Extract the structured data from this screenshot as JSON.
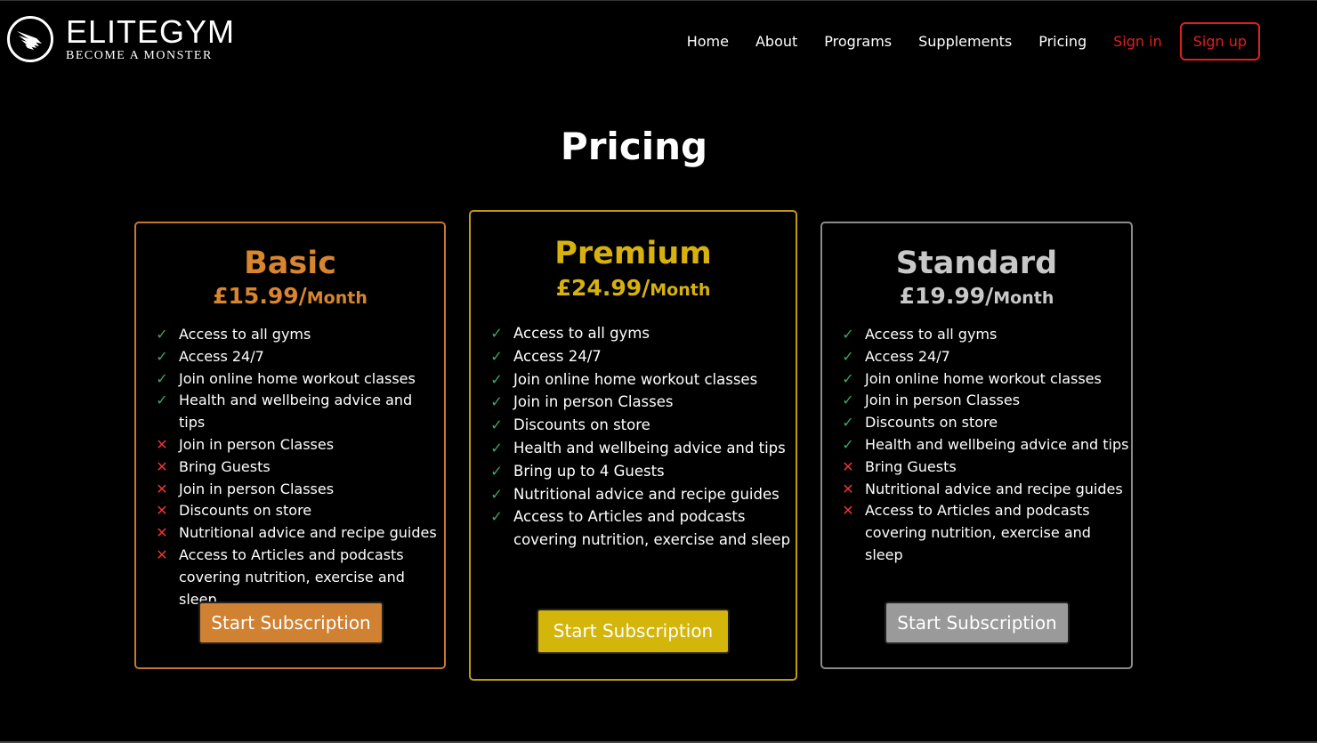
{
  "header": {
    "brand": "ELITEGYM",
    "tagline": "BECOME A MONSTER",
    "nav": [
      "Home",
      "About",
      "Programs",
      "Supplements",
      "Pricing"
    ],
    "signin": "Sign in",
    "signup": "Sign up"
  },
  "page_title": "Pricing",
  "colors": {
    "accent_red": "#e0201e",
    "basic": "#d8852f",
    "premium": "#d7b20e",
    "standard": "#c8c8c8",
    "check": "#3aa86a",
    "cross": "#e33333"
  },
  "plans": [
    {
      "name": "Basic",
      "price": "£15.99/",
      "unit": "Month",
      "button": "Start Subscription",
      "features": [
        {
          "text": "Access to all gyms",
          "included": true
        },
        {
          "text": "Access 24/7",
          "included": true
        },
        {
          "text": "Join online home workout classes",
          "included": true
        },
        {
          "text": "Health and wellbeing advice and tips",
          "included": true
        },
        {
          "text": "Join in person Classes",
          "included": false
        },
        {
          "text": "Bring Guests",
          "included": false
        },
        {
          "text": "Join in person Classes",
          "included": false
        },
        {
          "text": "Discounts on store",
          "included": false
        },
        {
          "text": "Nutritional advice and recipe guides",
          "included": false
        },
        {
          "text": "Access to Articles and podcasts covering nutrition, exercise and sleep",
          "included": false
        }
      ]
    },
    {
      "name": "Premium",
      "price": "£24.99/",
      "unit": "Month",
      "button": "Start Subscription",
      "features": [
        {
          "text": "Access to all gyms",
          "included": true
        },
        {
          "text": "Access 24/7",
          "included": true
        },
        {
          "text": "Join online home workout classes",
          "included": true
        },
        {
          "text": "Join in person Classes",
          "included": true
        },
        {
          "text": "Discounts on store",
          "included": true
        },
        {
          "text": "Health and wellbeing advice and tips",
          "included": true
        },
        {
          "text": "Bring up to 4 Guests",
          "included": true
        },
        {
          "text": "Nutritional advice and recipe guides",
          "included": true
        },
        {
          "text": "Access to Articles and podcasts covering nutrition, exercise and sleep",
          "included": true
        }
      ]
    },
    {
      "name": "Standard",
      "price": "£19.99/",
      "unit": "Month",
      "button": "Start Subscription",
      "features": [
        {
          "text": "Access to all gyms",
          "included": true
        },
        {
          "text": "Access 24/7",
          "included": true
        },
        {
          "text": "Join online home workout classes",
          "included": true
        },
        {
          "text": "Join in person Classes",
          "included": true
        },
        {
          "text": "Discounts on store",
          "included": true
        },
        {
          "text": "Health and wellbeing advice and tips",
          "included": true
        },
        {
          "text": "Bring Guests",
          "included": false
        },
        {
          "text": "Nutritional advice and recipe guides",
          "included": false
        },
        {
          "text": "Access to Articles and podcasts covering nutrition, exercise and sleep",
          "included": false
        }
      ]
    }
  ]
}
